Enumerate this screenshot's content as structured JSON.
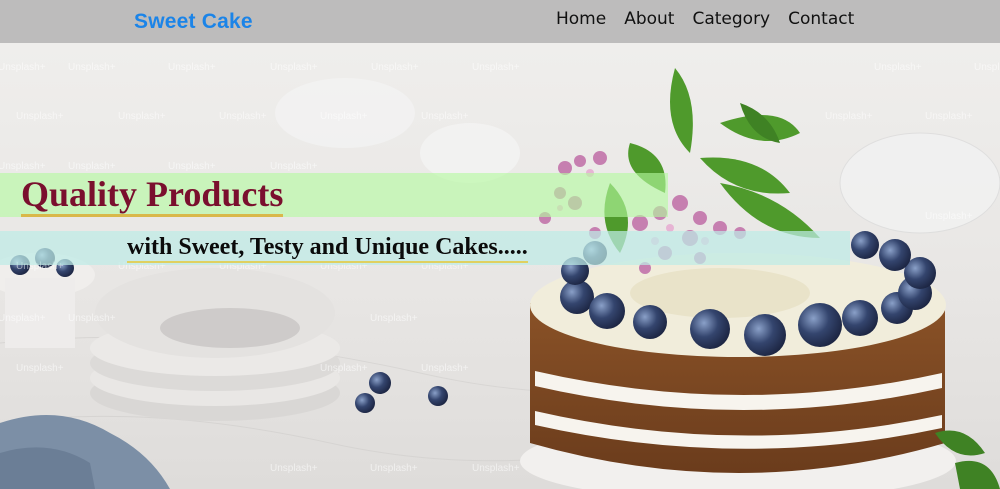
{
  "navbar": {
    "brand": "Sweet Cake",
    "links": [
      {
        "label": "Home"
      },
      {
        "label": "About"
      },
      {
        "label": "Category"
      },
      {
        "label": "Contact"
      }
    ]
  },
  "hero": {
    "headline": "Quality Products",
    "subline": "with Sweet, Testy and Unique Cakes.....",
    "watermark_text": "Unsplash+"
  },
  "colors": {
    "navbar_bg": "#bdbcbc",
    "brand": "#1b84e8",
    "headline": "#7a0f2e",
    "band_green": "#b4faa0",
    "band_cyan": "#beebe6"
  }
}
